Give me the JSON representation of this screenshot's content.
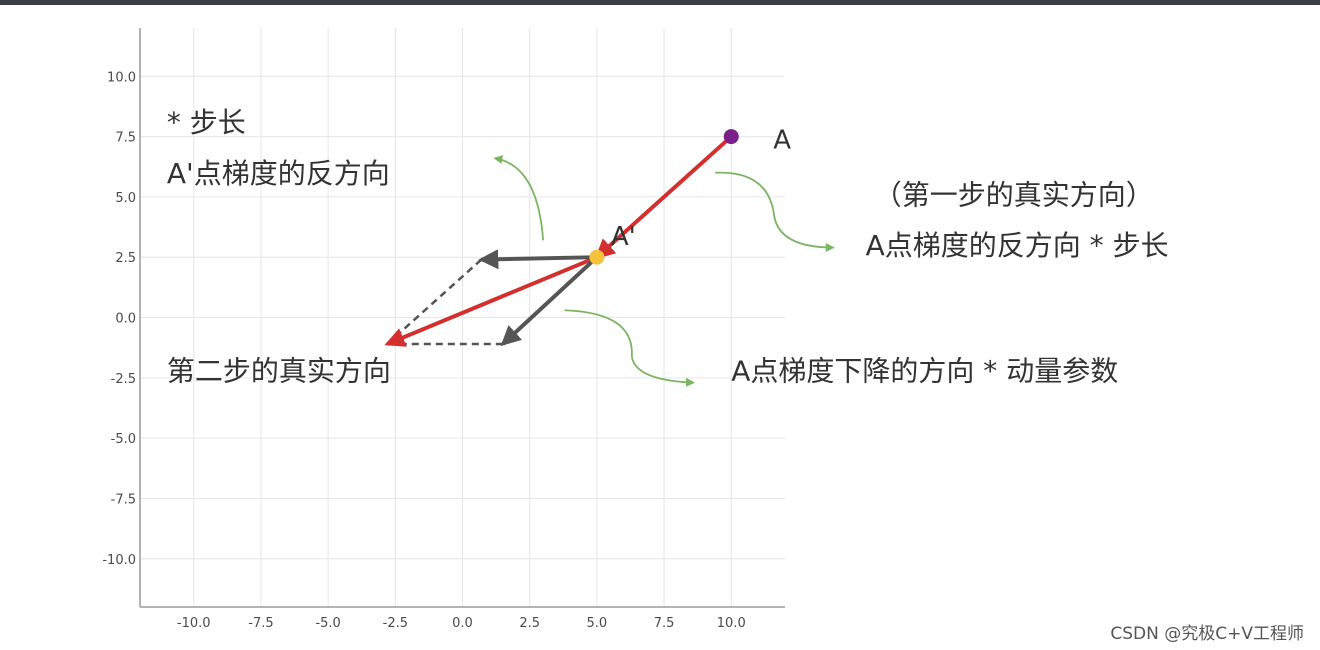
{
  "chart_data": {
    "type": "scatter",
    "xlim": [
      -12,
      12
    ],
    "ylim": [
      12,
      -12
    ],
    "y_axis_inverted": true,
    "grid": true,
    "x_ticks": [
      -10.0,
      -7.5,
      -5.0,
      -2.5,
      0.0,
      2.5,
      5.0,
      7.5,
      10.0
    ],
    "y_ticks": [
      -10.0,
      -7.5,
      -5.0,
      -2.5,
      0.0,
      2.5,
      5.0,
      7.5,
      10.0
    ],
    "x_tick_labels": [
      "-10.0",
      "-7.5",
      "-5.0",
      "-2.5",
      "0.0",
      "2.5",
      "5.0",
      "7.5",
      "10.0"
    ],
    "y_tick_labels": [
      "-10.0",
      "-7.5",
      "-5.0",
      "-2.5",
      "0.0",
      "2.5",
      "5.0",
      "7.5",
      "10.0"
    ],
    "points": [
      {
        "label": "A",
        "x": 10.0,
        "y": 7.5,
        "color": "#7b1f8a"
      },
      {
        "label": "A'",
        "x": 5.0,
        "y": 2.5,
        "color": "#f6c13b"
      }
    ],
    "vectors": [
      {
        "from": [
          10.0,
          7.5
        ],
        "to": [
          5.0,
          2.5
        ],
        "color": "#d32f2f"
      },
      {
        "from": [
          5.0,
          2.5
        ],
        "to": [
          -2.8,
          -1.1
        ],
        "color": "#d32f2f"
      },
      {
        "from": [
          5.0,
          2.5
        ],
        "to": [
          1.5,
          -1.1
        ],
        "color": "#555555"
      },
      {
        "from": [
          5.0,
          2.5
        ],
        "to": [
          0.7,
          2.4
        ],
        "color": "#555555"
      }
    ],
    "dashed_lines": [
      {
        "from": [
          1.5,
          -1.1
        ],
        "to": [
          -2.8,
          -1.1
        ],
        "color": "#555555"
      },
      {
        "from": [
          0.7,
          2.4
        ],
        "to": [
          -2.8,
          -1.1
        ],
        "color": "#555555"
      }
    ],
    "annotations": [
      {
        "text": "第二步的真实方向",
        "x": -11,
        "y": -2.2
      },
      {
        "text": "A点梯度下降的方向 * 动量参数",
        "x": 10.0,
        "y": -2.2
      },
      {
        "text": "A点梯度的反方向 * 步长",
        "x": 15.0,
        "y": 3.0
      },
      {
        "text": "（第一步的真实方向）",
        "x": 15.3,
        "y": 5.1
      },
      {
        "text": "A'点梯度的反方向",
        "x": -11,
        "y": 6.0
      },
      {
        "text": "* 步长",
        "x": -11,
        "y": 8.1
      }
    ],
    "colors": {
      "red": "#d32f2f",
      "dark": "#555555",
      "green": "#7cb561",
      "grid": "#e6e6e6"
    }
  },
  "watermark": "CSDN @究极C+V工程师"
}
